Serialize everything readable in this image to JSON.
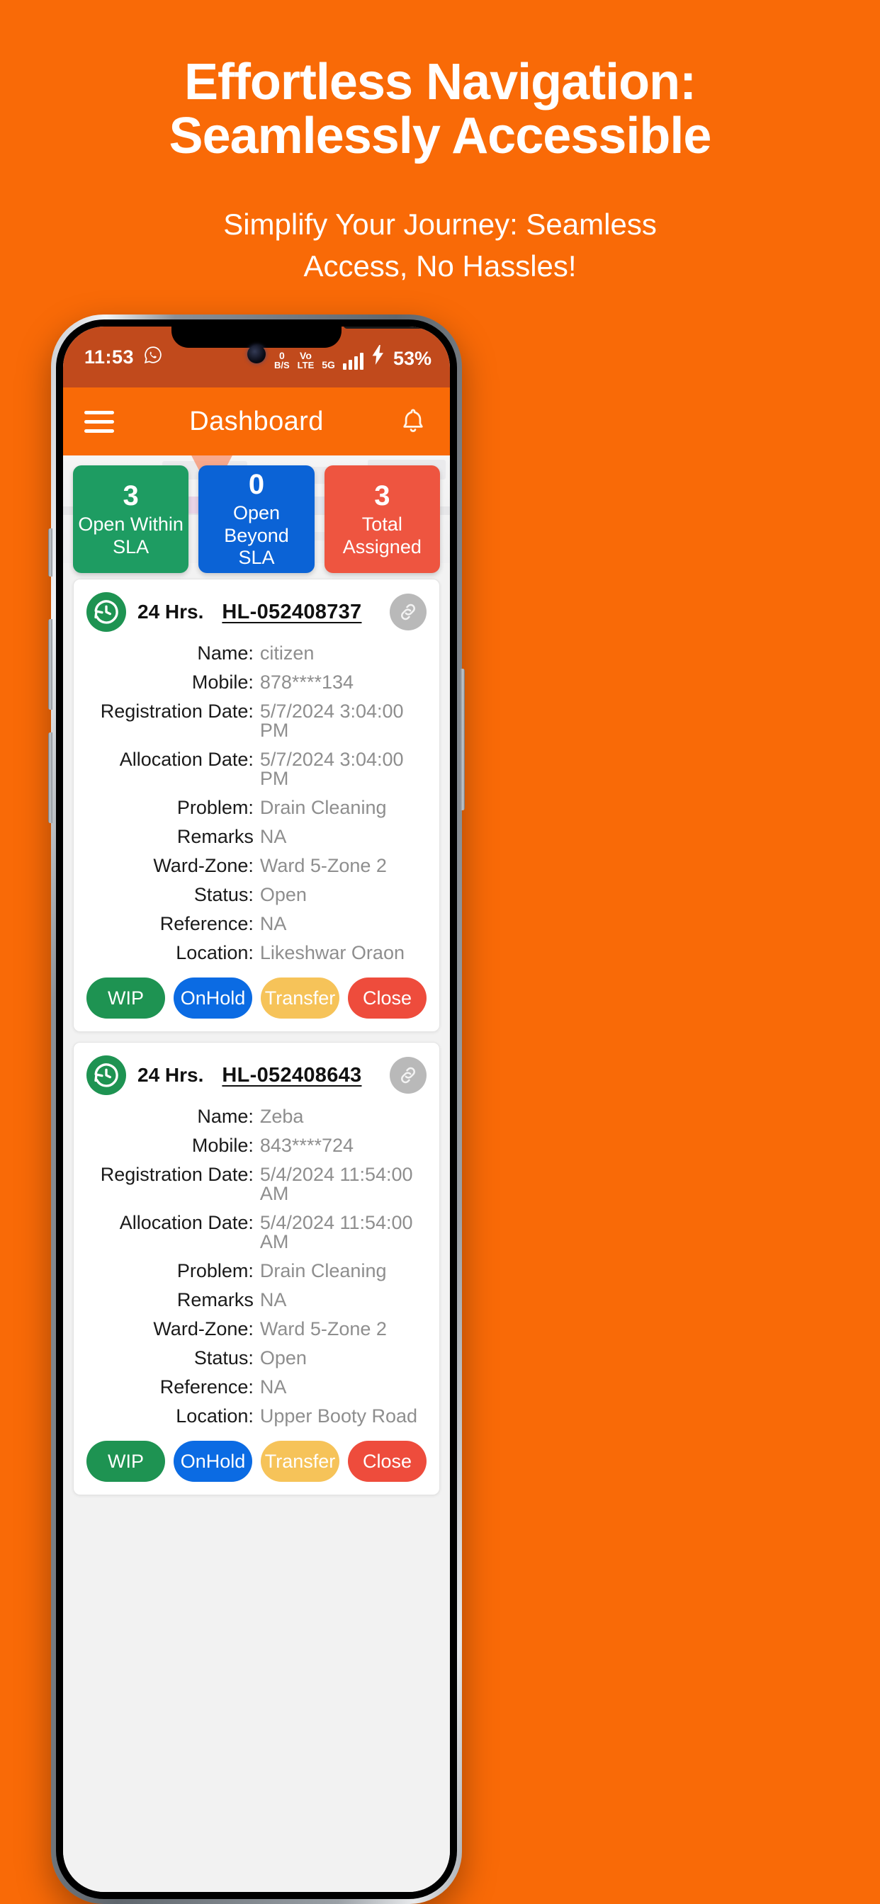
{
  "promo": {
    "title_line1": "Effortless Navigation:",
    "title_line2": "Seamlessly Accessible",
    "subtitle_line1": "Simplify Your Journey: Seamless",
    "subtitle_line2": "Access, No Hassles!",
    "background_color": "#F96A07",
    "text_color": "#FFFFFF"
  },
  "status_bar": {
    "time": "11:53",
    "whatsapp_icon": "whatsapp-icon",
    "data_rate": "0",
    "data_rate_unit": "B/S",
    "volte_top": "Vo",
    "volte_bottom": "LTE",
    "network": "5G",
    "charging_icon": "charging-bolt-icon",
    "battery": "53%",
    "background_color": "#C14A1C"
  },
  "app_bar": {
    "menu_icon": "hamburger-menu-icon",
    "title": "Dashboard",
    "bell_icon": "notification-bell-icon",
    "background_color": "#F96A07"
  },
  "stats": [
    {
      "value": "3",
      "label_line1": "Open Within",
      "label_line2": "SLA",
      "color": "#1E9C62"
    },
    {
      "value": "0",
      "label_line1": "Open Beyond",
      "label_line2": "SLA",
      "color": "#0B63D6"
    },
    {
      "value": "3",
      "label_line1": "Total",
      "label_line2": "Assigned",
      "color": "#EE5540"
    }
  ],
  "action_buttons": [
    {
      "label": "WIP",
      "color": "#1E9352"
    },
    {
      "label": "OnHold",
      "color": "#0B6BE3"
    },
    {
      "label": "Transfer",
      "color": "#F6C359"
    },
    {
      "label": "Close",
      "color": "#EE4C3C"
    }
  ],
  "tickets": [
    {
      "clock_icon": "history-clock-icon",
      "hours": "24 Hrs.",
      "id": "HL-052408737",
      "link_icon": "link-chain-icon",
      "fields": [
        {
          "key": "Name:",
          "value": "citizen"
        },
        {
          "key": "Mobile:",
          "value": "878****134"
        },
        {
          "key": "Registration Date:",
          "value": "5/7/2024 3:04:00 PM"
        },
        {
          "key": "Allocation Date:",
          "value": "5/7/2024 3:04:00 PM"
        },
        {
          "key": "Problem:",
          "value": "Drain Cleaning"
        },
        {
          "key": "Remarks",
          "value": "NA"
        },
        {
          "key": "Ward-Zone:",
          "value": "Ward 5-Zone 2"
        },
        {
          "key": "Status:",
          "value": "Open"
        },
        {
          "key": "Reference:",
          "value": "NA"
        },
        {
          "key": "Location:",
          "value": "Likeshwar Oraon"
        }
      ]
    },
    {
      "clock_icon": "history-clock-icon",
      "hours": "24 Hrs.",
      "id": "HL-052408643",
      "link_icon": "link-chain-icon",
      "fields": [
        {
          "key": "Name:",
          "value": "Zeba"
        },
        {
          "key": "Mobile:",
          "value": "843****724"
        },
        {
          "key": "Registration Date:",
          "value": "5/4/2024 11:54:00 AM"
        },
        {
          "key": "Allocation Date:",
          "value": "5/4/2024 11:54:00 AM"
        },
        {
          "key": "Problem:",
          "value": "Drain Cleaning"
        },
        {
          "key": "Remarks",
          "value": "NA"
        },
        {
          "key": "Ward-Zone:",
          "value": "Ward 5-Zone 2"
        },
        {
          "key": "Status:",
          "value": "Open"
        },
        {
          "key": "Reference:",
          "value": "NA"
        },
        {
          "key": "Location:",
          "value": "Upper Booty Road"
        }
      ]
    }
  ]
}
